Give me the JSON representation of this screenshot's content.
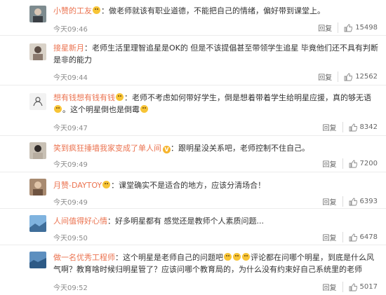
{
  "comments": [
    {
      "user": "小赞的工友",
      "text": "：做老师就该有职业道德，不能把自己的情绪，偏好带到课堂上。",
      "emojis": [],
      "time": "今天09:46",
      "reply": "回复",
      "likes": "15498"
    },
    {
      "user": "接星新月",
      "text": "：老师生活里理智追星是OK的 但是不该提倡甚至带领学生追星 毕竟他们还不具有判断是非的能力",
      "emojis": [],
      "time": "今天09:44",
      "reply": "回复",
      "likes": "12562"
    },
    {
      "user": "想有钱想有钱有钱",
      "text": "：老师不考虑如何带好学生，倒是想着带着学生给明星应援，真的够无语",
      "text2": "。这个明星倒也是倒霉",
      "time": "今天09:47",
      "reply": "回复",
      "likes": "8342"
    },
    {
      "user": "笑到疯狂捶墙我家变成了单人间",
      "text": "：跟明星没关系吧，老师控制不住自己。",
      "time": "今天09:49",
      "reply": "回复",
      "likes": "7200"
    },
    {
      "user": "月赞-DAYTOY",
      "text": "：课堂确实不是适合的地方，应该分清场合！",
      "time": "今天09:49",
      "reply": "回复",
      "likes": "6393"
    },
    {
      "user": "人间值得好心情",
      "text": "：好多明星都有 感觉还是教师个人素质问题...",
      "time": "今天09:50",
      "reply": "回复",
      "likes": "6478"
    },
    {
      "user": "做一名优秀工程师",
      "text": "：这个明星是老师自己的问题吧",
      "text2": "评论都在问哪个明星，到底是什么风气啊？教育啥时候归明星管了？应该问哪个教育局的，为什么没有约束好自己系统里的老师",
      "time": "今天09:52",
      "reply": "回复",
      "likes": "5017"
    }
  ],
  "icons": {
    "like": "thumbs-up-icon",
    "verified": "v-badge-icon"
  }
}
